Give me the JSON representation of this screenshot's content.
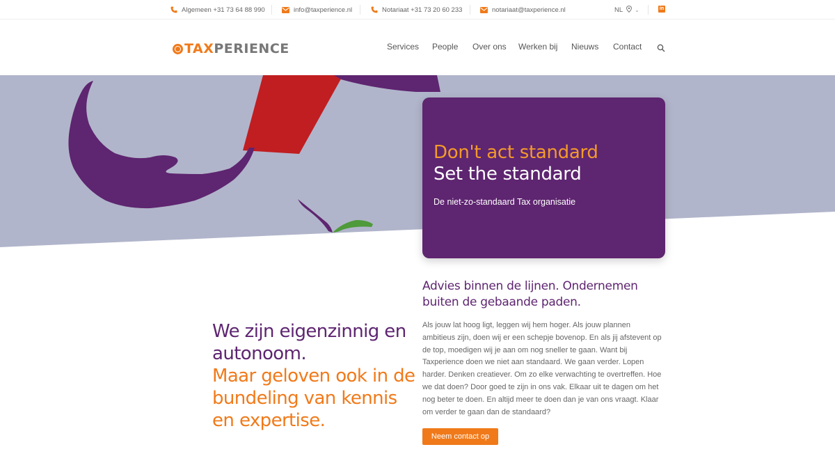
{
  "topbar": {
    "general_phone": "Algemeen +31 73 64 88 990",
    "info_email": "info@taxperience.nl",
    "notary_phone": "Notariaat +31 73 20 60 233",
    "notary_email": "notariaat@taxperience.nl",
    "language": "NL",
    "social": "in"
  },
  "header": {
    "logo_part1": "TAX",
    "logo_part2": "PERIENCE",
    "nav": [
      "Services",
      "People",
      "Over ons",
      "Werken bij",
      "Nieuws",
      "Contact"
    ]
  },
  "hero": {
    "headline_1": "Don't act standard",
    "headline_2": "Set the standard",
    "subline": "De niet-zo-standaard Tax organisatie"
  },
  "content": {
    "lead_purple": "We zijn eigenzinnig en autonoom.",
    "lead_orange": "Maar geloven ook in de bundeling van kennis en expertise.",
    "intro_title": "Advies binnen de lijnen. Ondernemen buiten de gebaande paden.",
    "intro_body": "Als jouw lat hoog ligt, leggen wij hem hoger. Als jouw plannen ambitieus zijn, doen wij er een schepje bovenop. En als jij afstevent op de top, moedigen wij je aan om nog sneller te gaan. Want bij Taxperience doen we niet aan standaard. We gaan verder. Lopen harder. Denken creatiever. Om zo elke verwachting te overtreffen. Hoe we dat doen? Door goed te zijn in ons vak. Elkaar uit te dagen om het nog beter te doen. En altijd meer te doen dan je van ons vraagt. Klaar om verder te gaan dan de standaard?",
    "cta_label": "Neem contact op"
  },
  "colors": {
    "brand_orange": "#f07a1a",
    "brand_purple": "#5e2570",
    "hero_bg": "#b1b5cb",
    "accent_red": "#c01e21",
    "accent_green": "#4f9a3a"
  }
}
